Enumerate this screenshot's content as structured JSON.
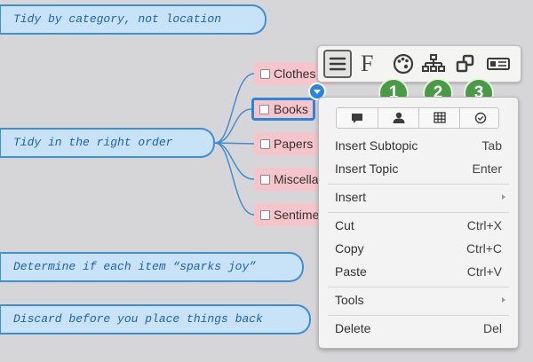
{
  "topics": [
    "Tidy by category, not location",
    "Tidy in the right order",
    "Determine if each item “sparks joy”",
    "Discard before you place things back"
  ],
  "subtopics": [
    "Clothes",
    "Books",
    "Papers",
    "Miscellaneous",
    "Sentimental"
  ],
  "toolbar": {
    "font_label": "F",
    "buttons": [
      "menu-icon",
      "font-icon",
      "palette-icon",
      "structure-icon",
      "link-icon",
      "card-icon"
    ]
  },
  "badges": [
    "1",
    "2",
    "3"
  ],
  "menu": {
    "icon_row": [
      "comment-icon",
      "person-icon",
      "grid-icon",
      "check-circle-icon"
    ],
    "insert_subtopic": {
      "label": "Insert Subtopic",
      "shortcut": "Tab"
    },
    "insert_topic": {
      "label": "Insert Topic",
      "shortcut": "Enter"
    },
    "insert": {
      "label": "Insert"
    },
    "cut": {
      "label": "Cut",
      "shortcut": "Ctrl+X"
    },
    "copy": {
      "label": "Copy",
      "shortcut": "Ctrl+C"
    },
    "paste": {
      "label": "Paste",
      "shortcut": "Ctrl+V"
    },
    "tools": {
      "label": "Tools"
    },
    "delete": {
      "label": "Delete",
      "shortcut": "Del"
    }
  },
  "colors": {
    "canvas": "#d6d6d8",
    "topic_fill": "#c8e2f7",
    "topic_border": "#3f8fd2",
    "subtopic_fill": "#f6c5cc",
    "selection": "#2a86dd",
    "badge": "#4a9b46"
  }
}
